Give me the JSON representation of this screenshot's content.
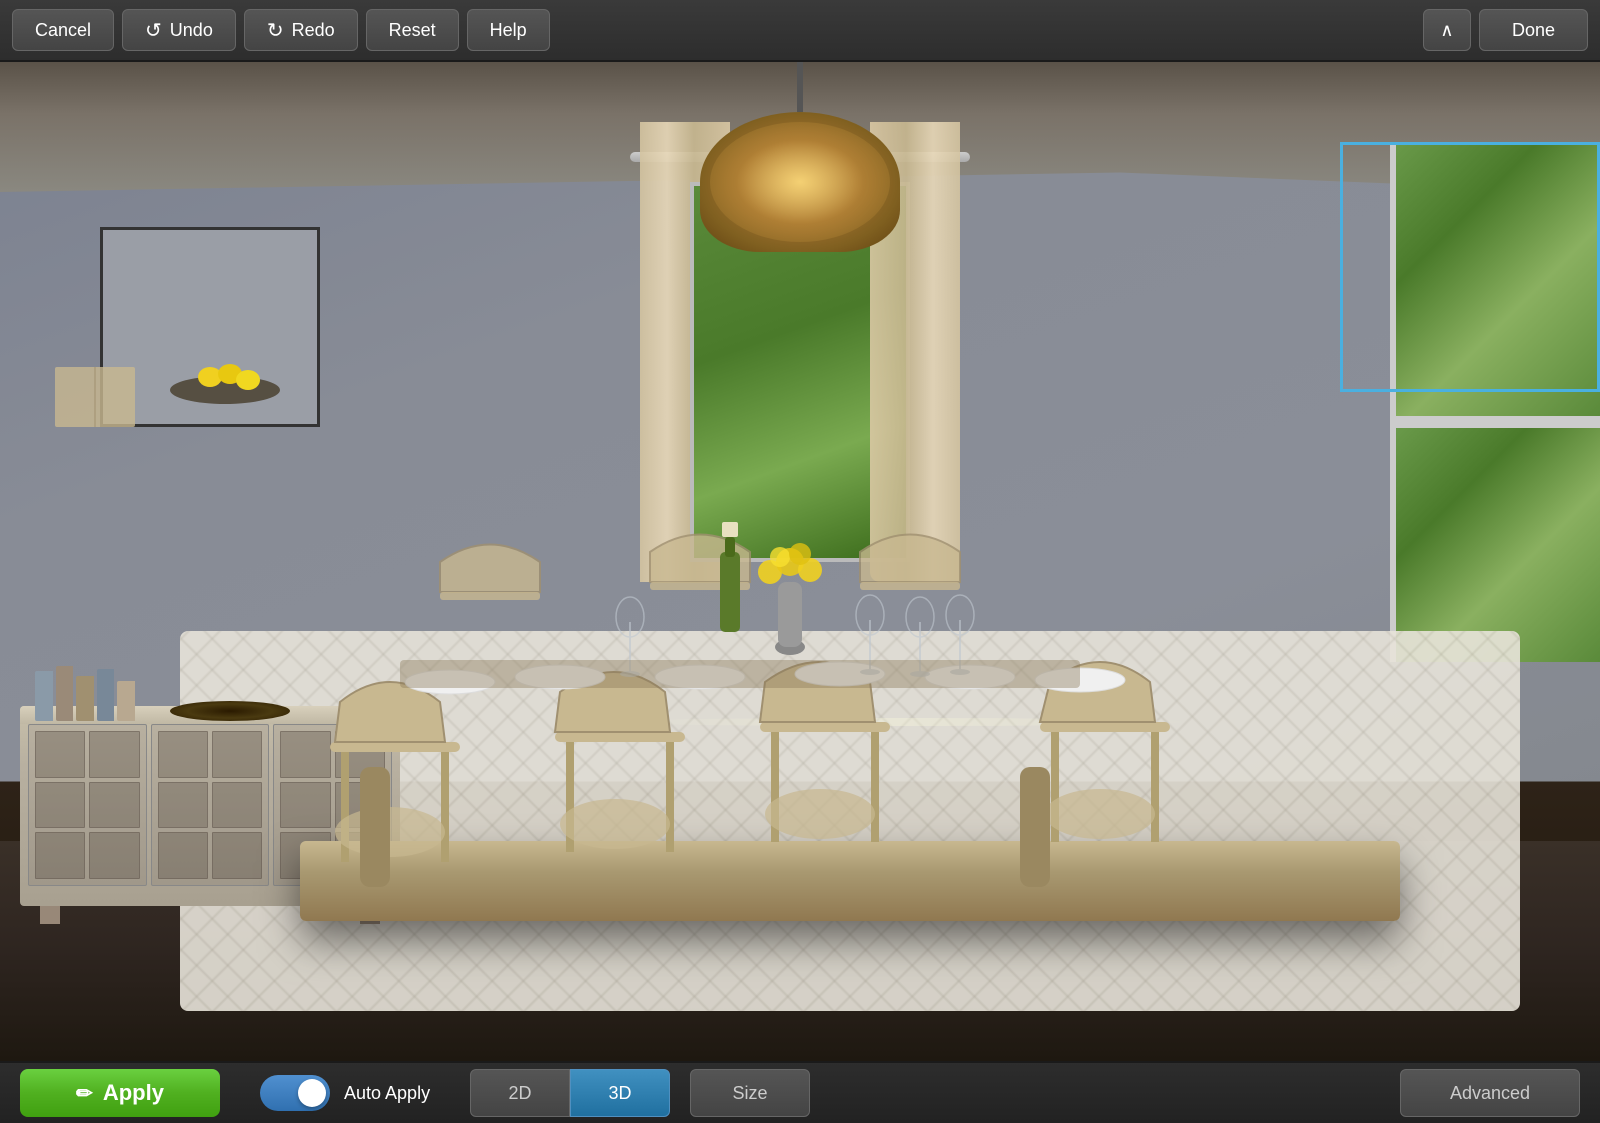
{
  "toolbar": {
    "cancel_label": "Cancel",
    "undo_label": "Undo",
    "redo_label": "Redo",
    "reset_label": "Reset",
    "help_label": "Help",
    "done_label": "Done",
    "chevron_symbol": "∧"
  },
  "bottom_bar": {
    "apply_label": "Apply",
    "apply_icon": "✏",
    "auto_apply_label": "Auto Apply",
    "view_2d_label": "2D",
    "view_3d_label": "3D",
    "size_label": "Size",
    "advanced_label": "Advanced"
  },
  "colors": {
    "apply_green": "#5bc832",
    "active_blue": "#3080b8",
    "toolbar_bg": "#333",
    "selection_blue": "#4ab0e0"
  },
  "scene": {
    "description": "Dining room 3D render with table, chairs, chandelier, sideboard",
    "selection_box_visible": true
  }
}
